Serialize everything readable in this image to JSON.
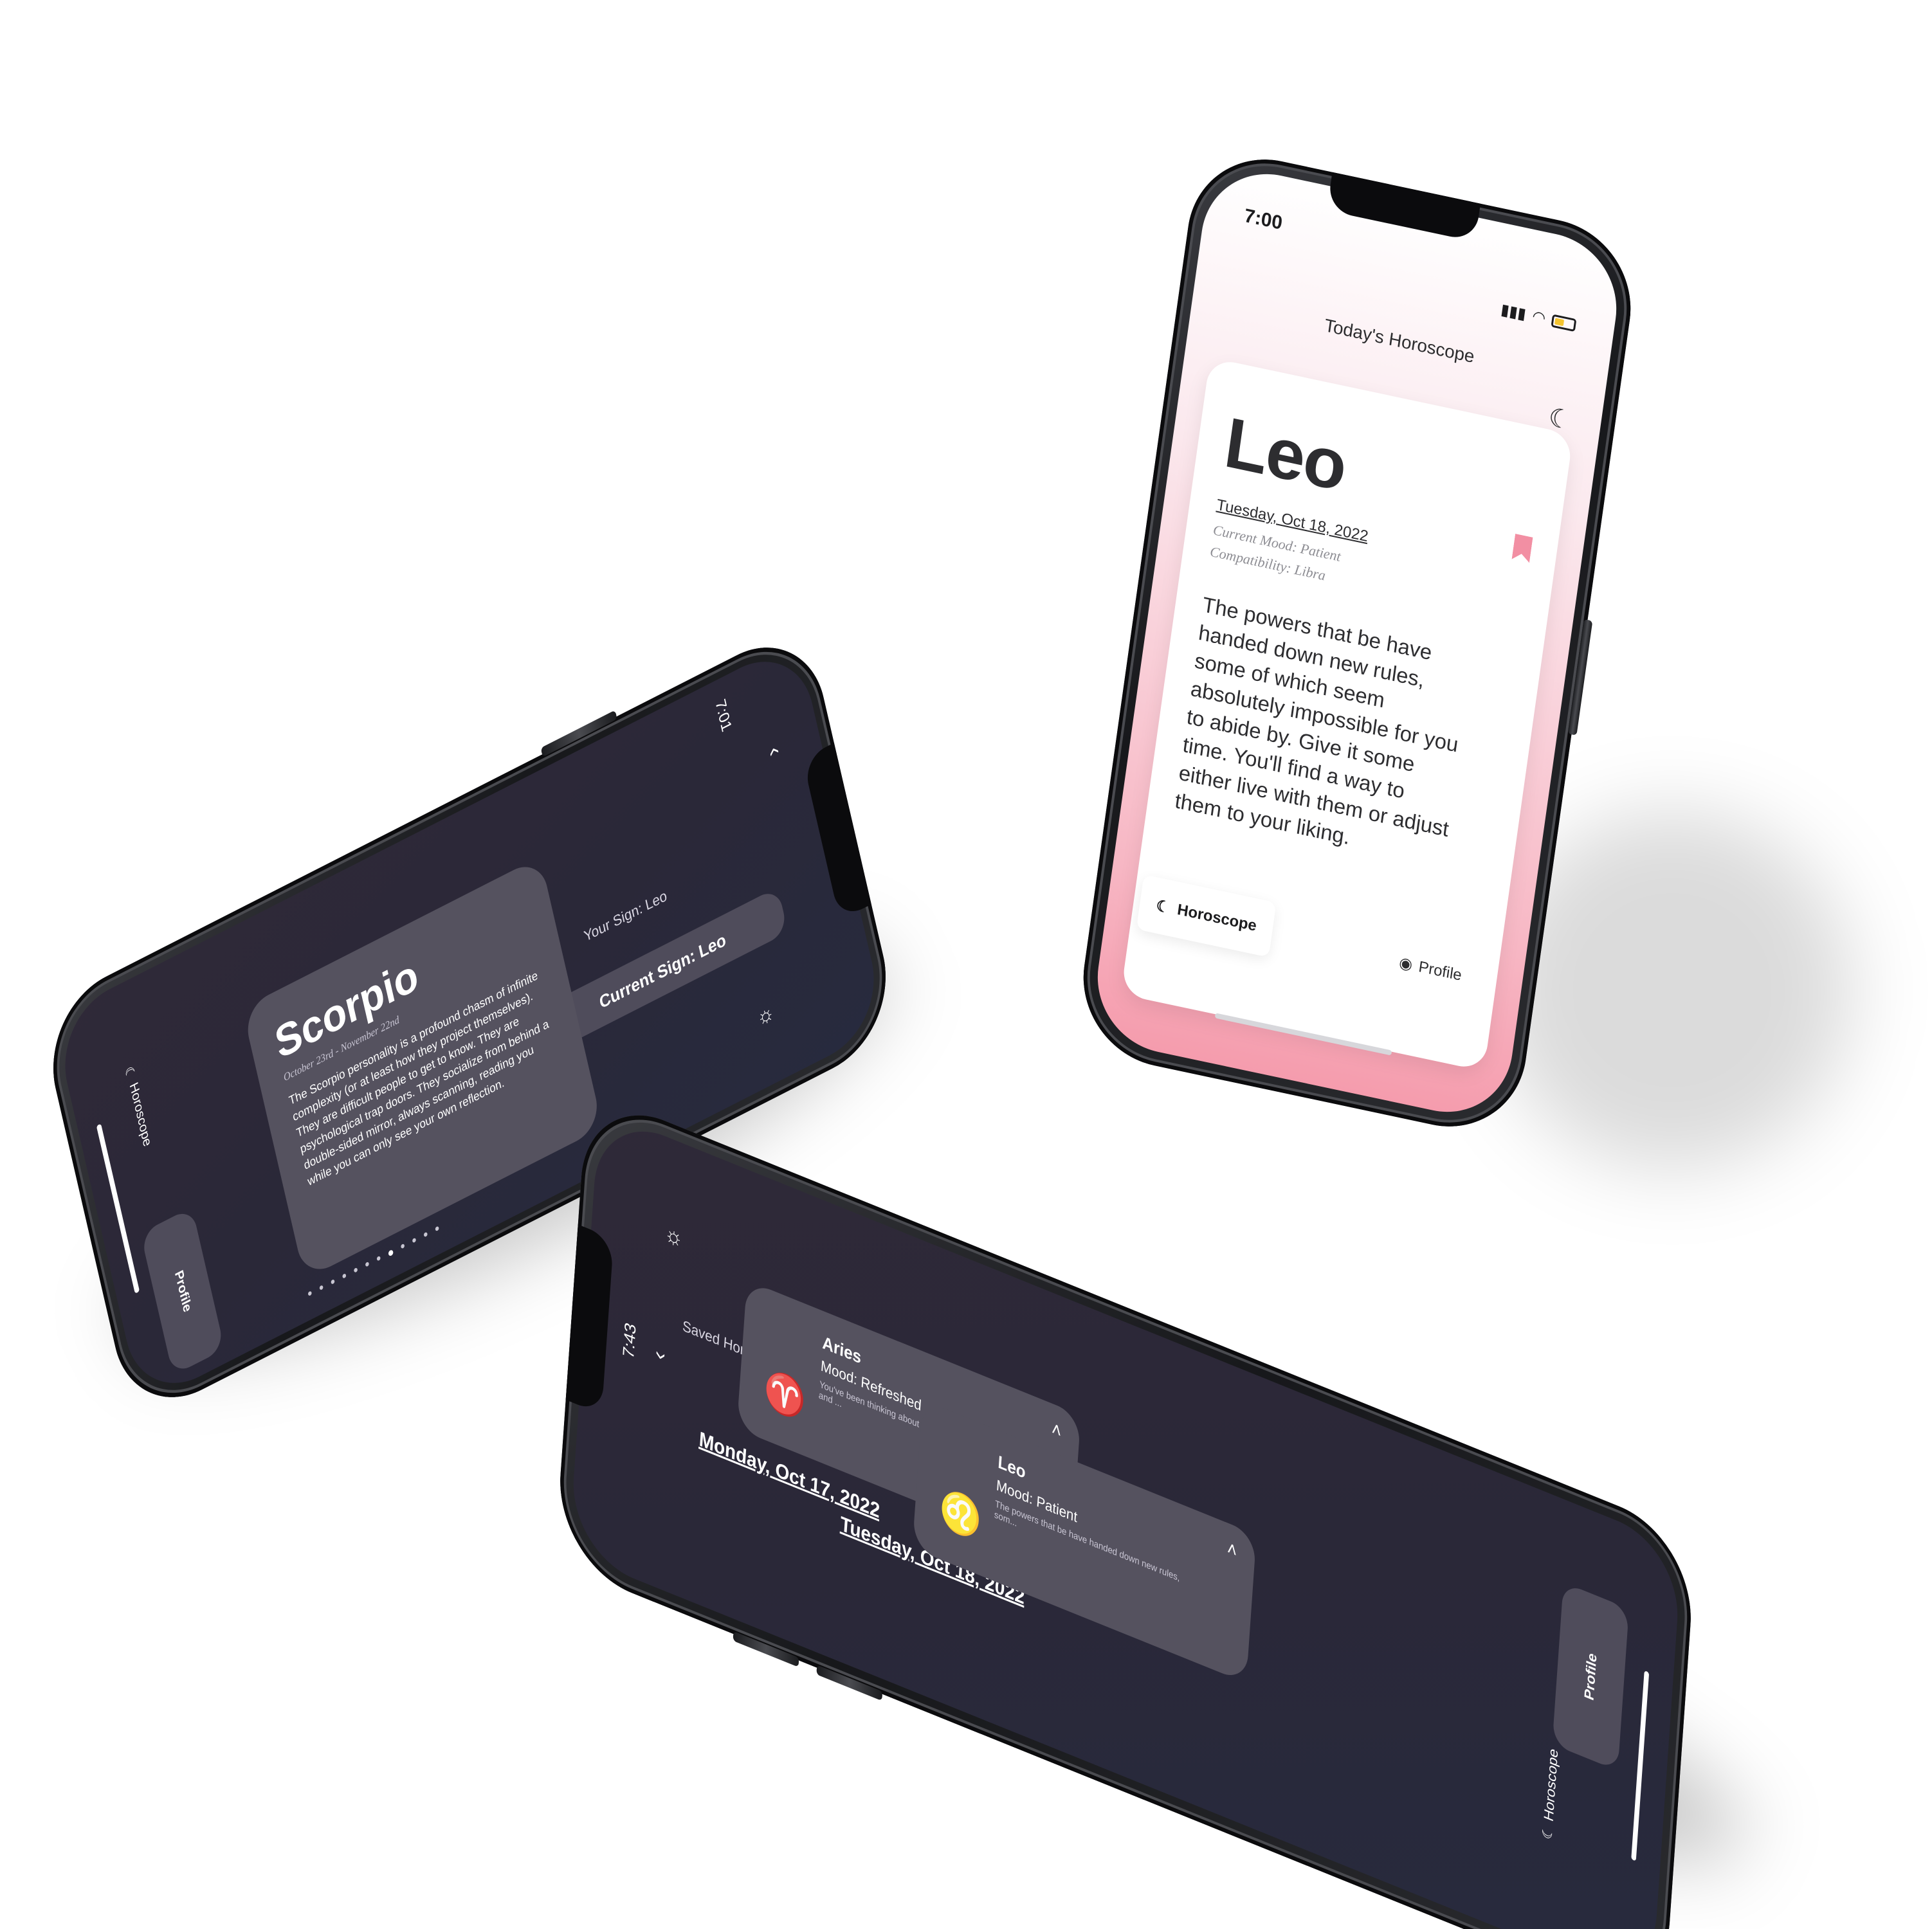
{
  "light_phone": {
    "time": "7:00",
    "header": "Today's Horoscope",
    "theme_icon": "moon-icon",
    "sign": "Leo",
    "date": "Tuesday, Oct 18, 2022",
    "mood": "Current Mood: Patient",
    "compatibility": "Compatibility: Libra",
    "body": "The powers that be have handed down new rules, some of which seem absolutely impossible for you to abide by. Give it some time. You'll find a way to either live with them or adjust them to your liking.",
    "tab_horoscope": "Horoscope",
    "tab_profile": "Profile",
    "colors": {
      "accent": "#f28fa3",
      "background_top": "#ffffff",
      "background_bottom": "#f59cad"
    }
  },
  "sign_phone": {
    "time": "7:01",
    "header": "Your Sign: Leo",
    "current_sign_pill": "Current Sign: Leo",
    "sign": "Scorpio",
    "date_range": "October 23rd - November 22nd",
    "body": "The Scorpio personality is a profound chasm of infinite complexity (or at least how they project themselves). They are difficult people to get to know. They are psychological trap doors. They socialize from behind a double-sided mirror, always scanning, reading you while you can only see your own reflection.",
    "tab_horoscope": "Horoscope",
    "tab_profile": "Profile",
    "theme_icon": "sun-icon",
    "page_count": 12,
    "active_page": 7
  },
  "saved_phone": {
    "time": "7:43",
    "header": "Saved Horoscopes",
    "theme_icon": "sun-icon",
    "entries": [
      {
        "date": "Monday, Oct 17, 2022",
        "sign": "Aries",
        "mood": "Mood: Refreshed",
        "snippet": "You've been thinking about someone for months and ..."
      },
      {
        "date": "Tuesday, Oct 18, 2022",
        "sign": "Leo",
        "mood": "Mood: Patient",
        "snippet": "The powers that be have handed down new rules, som..."
      }
    ],
    "tab_horoscope": "Horoscope",
    "tab_profile": "Profile"
  }
}
